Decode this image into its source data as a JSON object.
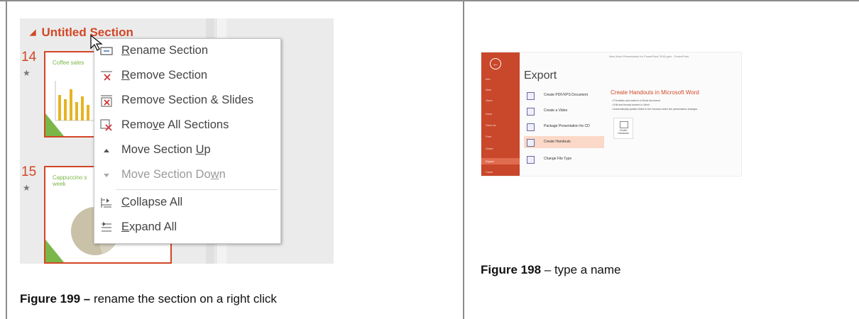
{
  "left_figure": {
    "section_title": "Untitled Section",
    "slides": [
      {
        "number": "14",
        "title": "Coffee sales"
      },
      {
        "number": "15",
        "title": "Cappuccino s week"
      }
    ],
    "context_menu": {
      "items": [
        {
          "pre": "",
          "u": "R",
          "post": "ename Section",
          "icon": "rename-section-icon",
          "disabled": false
        },
        {
          "pre": "",
          "u": "R",
          "post": "emove Section",
          "icon": "remove-section-icon",
          "disabled": false
        },
        {
          "pre": "Remove Section & Slides",
          "u": "",
          "post": "",
          "icon": "remove-section-slides-icon",
          "disabled": false
        },
        {
          "pre": "Remo",
          "u": "v",
          "post": "e All Sections",
          "icon": "remove-all-sections-icon",
          "disabled": false
        },
        {
          "pre": "Move Section ",
          "u": "U",
          "post": "p",
          "icon": "move-up-icon",
          "disabled": false
        },
        {
          "pre": "Move Section Do",
          "u": "w",
          "post": "n",
          "icon": "move-down-icon",
          "disabled": true
        },
        {
          "pre": "",
          "u": "C",
          "post": "ollapse All",
          "icon": "collapse-all-icon",
          "disabled": false
        },
        {
          "pre": "",
          "u": "E",
          "post": "xpand All",
          "icon": "expand-all-icon",
          "disabled": false
        }
      ]
    },
    "caption": {
      "label": "Figure 199 –",
      "text": " rename the section on a right click"
    }
  },
  "right_figure": {
    "window_title": "New Word Presentation for PowerPoint 2016.pptx - PowerPoint",
    "backstage_nav": [
      "Info",
      "New",
      "Open",
      "Save",
      "Save As",
      "Print",
      "Share",
      "Export",
      "Close"
    ],
    "heading": "Export",
    "options": [
      {
        "label": "Create PDF/XPS Document",
        "selected": false
      },
      {
        "label": "Create a Video",
        "selected": false
      },
      {
        "label": "Package Presentation for CD",
        "selected": false
      },
      {
        "label": "Create Handouts",
        "selected": true
      },
      {
        "label": "Change File Type",
        "selected": false
      }
    ],
    "detail": {
      "title": "Create Handouts in Microsoft Word",
      "bullets": [
        "• Put slides and notes in a Word document",
        "• Edit and format content in Word",
        "• Automatically update slides in the handout when the presentation changes"
      ],
      "button_label": "Create Handouts"
    },
    "caption": {
      "label": "Figure 198",
      "text": " – type a name"
    }
  },
  "colors": {
    "accent": "#d24726",
    "backstage": "#c9472a",
    "divider": "#8c8c8c"
  }
}
